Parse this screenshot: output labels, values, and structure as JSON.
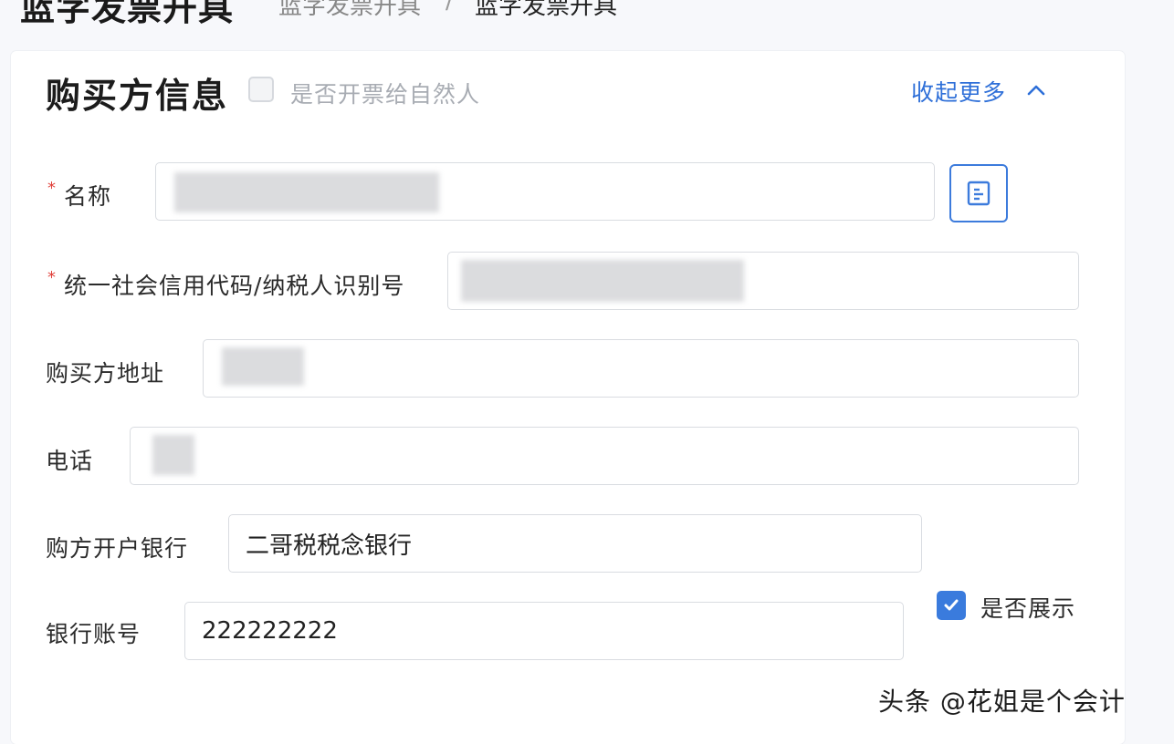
{
  "header": {
    "page_title": "蓝字发票开具",
    "breadcrumb": [
      "蓝字发票开具",
      "蓝字发票开具"
    ],
    "breadcrumb_separator": "/"
  },
  "buyer_section": {
    "title": "购买方信息",
    "natural_person_checkbox": {
      "label": "是否开票给自然人",
      "checked": false
    },
    "collapse_link": "收起更多",
    "accent_color": "#2e6fd8"
  },
  "fields": {
    "name": {
      "label": "名称",
      "required": true,
      "value": "",
      "redacted": true
    },
    "tax_id": {
      "label": "统一社会信用代码/纳税人识别号",
      "required": true,
      "value": "",
      "redacted": true
    },
    "address": {
      "label": "购买方地址",
      "required": false,
      "value": "",
      "redacted": true
    },
    "phone": {
      "label": "电话",
      "required": false,
      "value": "",
      "redacted": true
    },
    "bank": {
      "label": "购方开户银行",
      "required": false,
      "value": "二哥税税念银行"
    },
    "account": {
      "label": "银行账号",
      "required": false,
      "value": "222222222"
    }
  },
  "display_checkbox": {
    "label": "是否展示",
    "checked": true
  },
  "icons": {
    "lookup": "document-list-icon",
    "collapse": "chevron-up-icon",
    "check": "checkmark-icon"
  },
  "watermark": "头条 @花姐是个会计"
}
